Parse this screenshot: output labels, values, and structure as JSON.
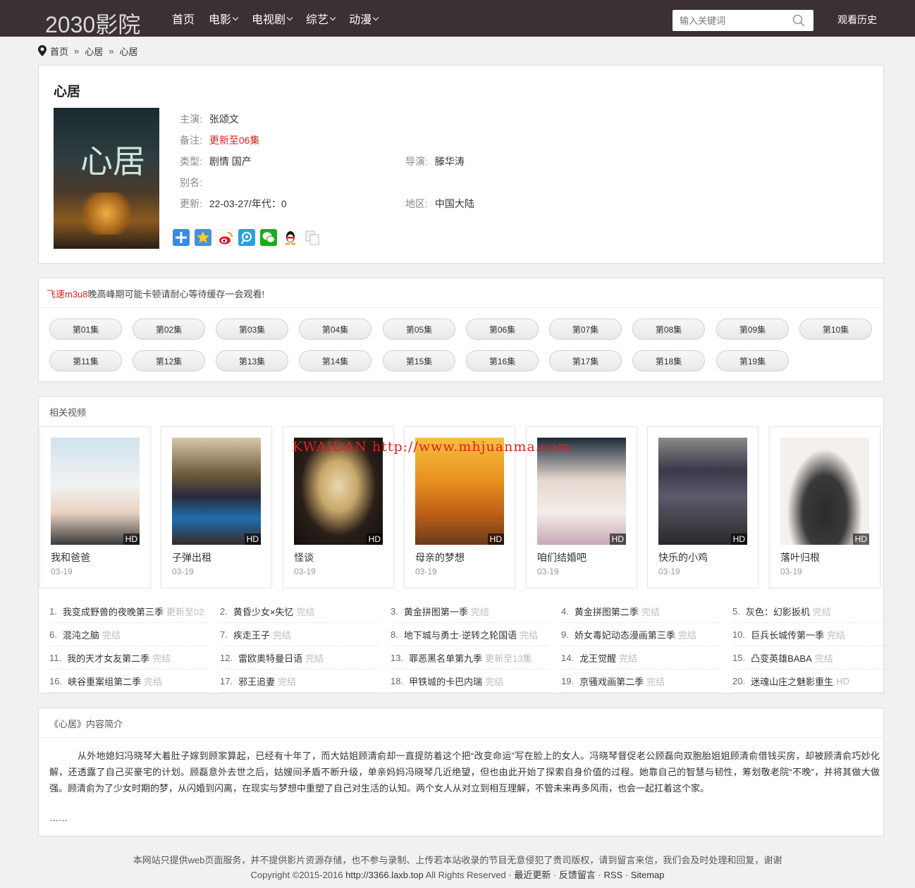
{
  "header": {
    "logo": "2030影院",
    "nav": [
      {
        "label": "首页",
        "dropdown": false
      },
      {
        "label": "电影",
        "dropdown": true
      },
      {
        "label": "电视剧",
        "dropdown": true
      },
      {
        "label": "综艺",
        "dropdown": true
      },
      {
        "label": "动漫",
        "dropdown": true
      }
    ],
    "search_placeholder": "输入关键词",
    "history": "观看历史"
  },
  "breadcrumb": [
    "首页",
    "心居",
    "心居"
  ],
  "detail": {
    "title": "心居",
    "poster_text": "心居",
    "fields": {
      "actor_label": "主演:",
      "actor": "张颂文",
      "note_label": "备注:",
      "note": "更新至06集",
      "type_label": "类型:",
      "type": "剧情 国产",
      "director_label": "导演:",
      "director": "滕华涛",
      "alias_label": "别名:",
      "alias": "",
      "update_label": "更新:",
      "update": "22-03-27/年代：0",
      "region_label": "地区:",
      "region": "中国大陆"
    },
    "share_icons": [
      "plus-icon",
      "star-icon",
      "weibo-icon",
      "tencent-weibo-icon",
      "wechat-icon",
      "qq-icon",
      "copy-icon"
    ]
  },
  "episodes": {
    "notice_red": "飞速m3u8",
    "notice_rest": "晚高峰期可能卡顿请耐心等待缓存一会观看!",
    "list": [
      "第01集",
      "第02集",
      "第03集",
      "第04集",
      "第05集",
      "第06集",
      "第07集",
      "第08集",
      "第09集",
      "第10集",
      "第11集",
      "第12集",
      "第13集",
      "第14集",
      "第15集",
      "第16集",
      "第17集",
      "第18集",
      "第19集"
    ]
  },
  "related": {
    "title": "相关视频",
    "watermark": "KWAIDAN http://www.mhjuanma.com",
    "cards": [
      {
        "title": "我和爸爸",
        "date": "03-19",
        "badge": "HD"
      },
      {
        "title": "子弹出租",
        "date": "03-19",
        "badge": "HD"
      },
      {
        "title": "怪谈",
        "date": "03-19",
        "badge": "HD"
      },
      {
        "title": "母亲的梦想",
        "date": "03-19",
        "badge": "HD"
      },
      {
        "title": "咱们结婚吧",
        "date": "03-19",
        "badge": "HD"
      },
      {
        "title": "快乐的小鸡",
        "date": "03-19",
        "badge": "HD"
      },
      {
        "title": "落叶归根",
        "date": "03-19",
        "badge": "HD"
      }
    ],
    "ranking": [
      {
        "num": "1.",
        "title": "我变成野兽的夜晚第三季",
        "status": "更新至02"
      },
      {
        "num": "2.",
        "title": "黄昏少女×失忆",
        "status": "完结"
      },
      {
        "num": "3.",
        "title": "黄金拼图第一季",
        "status": "完结"
      },
      {
        "num": "4.",
        "title": "黄金拼图第二季",
        "status": "完结"
      },
      {
        "num": "5.",
        "title": "灰色：幻影扳机",
        "status": "完结"
      },
      {
        "num": "6.",
        "title": "混沌之脑",
        "status": "完结"
      },
      {
        "num": "7.",
        "title": "疾走王子",
        "status": "完结"
      },
      {
        "num": "8.",
        "title": "地下城与勇士·逆转之轮国语",
        "status": "完结"
      },
      {
        "num": "9.",
        "title": "娇女毒妃动态漫画第三季",
        "status": "完结"
      },
      {
        "num": "10.",
        "title": "巨兵长城传第一季",
        "status": "完结"
      },
      {
        "num": "11.",
        "title": "我的天才女友第二季",
        "status": "完结"
      },
      {
        "num": "12.",
        "title": "雷欧奥特曼日语",
        "status": "完结"
      },
      {
        "num": "13.",
        "title": "罪恶黑名单第九季",
        "status": "更新至13集"
      },
      {
        "num": "14.",
        "title": "龙王觉醒",
        "status": "完结"
      },
      {
        "num": "15.",
        "title": "凸变英雄BABA",
        "status": "完结"
      },
      {
        "num": "16.",
        "title": "峡谷重案组第二季",
        "status": "完结"
      },
      {
        "num": "17.",
        "title": "邪王追妻",
        "status": "完结"
      },
      {
        "num": "18.",
        "title": "甲铁城的卡巴内瑞",
        "status": "完结"
      },
      {
        "num": "19.",
        "title": "京骚戏画第二季",
        "status": "完结"
      },
      {
        "num": "20.",
        "title": "迷魂山庄之魅影重生",
        "status": "HD"
      }
    ]
  },
  "synopsis": {
    "title": "《心居》内容简介",
    "body": "从外地媳妇冯晓琴大着肚子嫁到顾家算起，已经有十年了，而大姑姐顾清俞却一直提防着这个把“改变命运”写在脸上的女人。冯晓琴督促老公顾磊向双胞胎姐姐顾清俞借钱买房，却被顾清俞巧妙化解，还透露了自己买豪宅的计划。顾磊意外去世之后，姑嫂间矛盾不断升级，单亲妈妈冯晓琴几近绝望，但也由此开始了探索自身价值的过程。她靠自己的智慧与韧性，筹划敬老院“不晚”，并将其做大做强。顾清俞为了少女时期的梦，从闪婚到闪离，在现实与梦想中重塑了自己对生活的认知。两个女人从对立到相互理解，不管未来再多风雨，也会一起扛着这个家。",
    "more": "……"
  },
  "footer": {
    "disclaimer": "本网站只提供web页面服务，并不提供影片资源存储，也不参与录制、上传若本站收录的节目无意侵犯了贵司版权，请到留言来信，我们会及时处理和回复，谢谢",
    "copyright": "Copyright ©2015-2016",
    "url": "http://3366.laxb.top",
    "rights": "All Rights Reserved",
    "links": [
      "最近更新",
      "反馈留言",
      "RSS",
      "Sitemap"
    ]
  },
  "colors": {
    "header_bg": "#3b3132",
    "accent_red": "#e02020"
  }
}
